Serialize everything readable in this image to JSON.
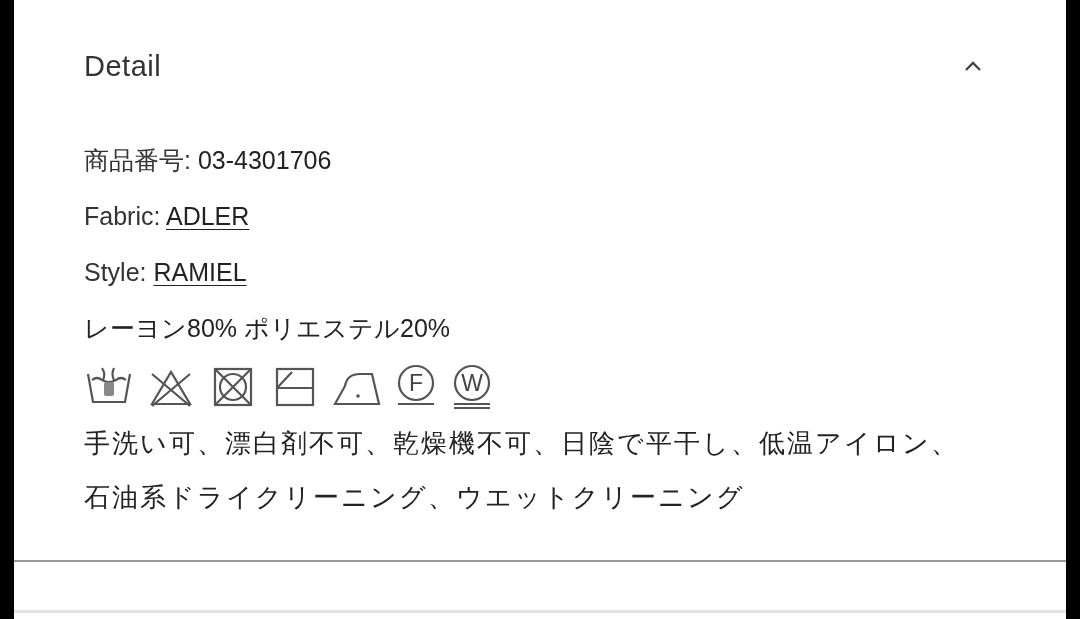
{
  "section": {
    "title": "Detail",
    "expanded": true,
    "specs": [
      {
        "label": "商品番号: ",
        "value": "03-4301706",
        "link": false
      },
      {
        "label": "Fabric: ",
        "value": "ADLER",
        "link": true
      },
      {
        "label": "Style: ",
        "value": "RAMIEL",
        "link": true
      }
    ],
    "composition": "レーヨン80% ポリエステル20%",
    "care_symbols": [
      {
        "kind": "handwash"
      },
      {
        "kind": "nobleach"
      },
      {
        "kind": "notumble"
      },
      {
        "kind": "flatshade"
      },
      {
        "kind": "ironlow"
      },
      {
        "kind": "dryclean",
        "letter": "F"
      },
      {
        "kind": "wetclean",
        "letter": "W"
      }
    ],
    "care_text": "手洗い可、漂白剤不可、乾燥機不可、日陰で平干し、低温アイロン、石油系ドライクリーニング、ウエットクリーニング"
  }
}
